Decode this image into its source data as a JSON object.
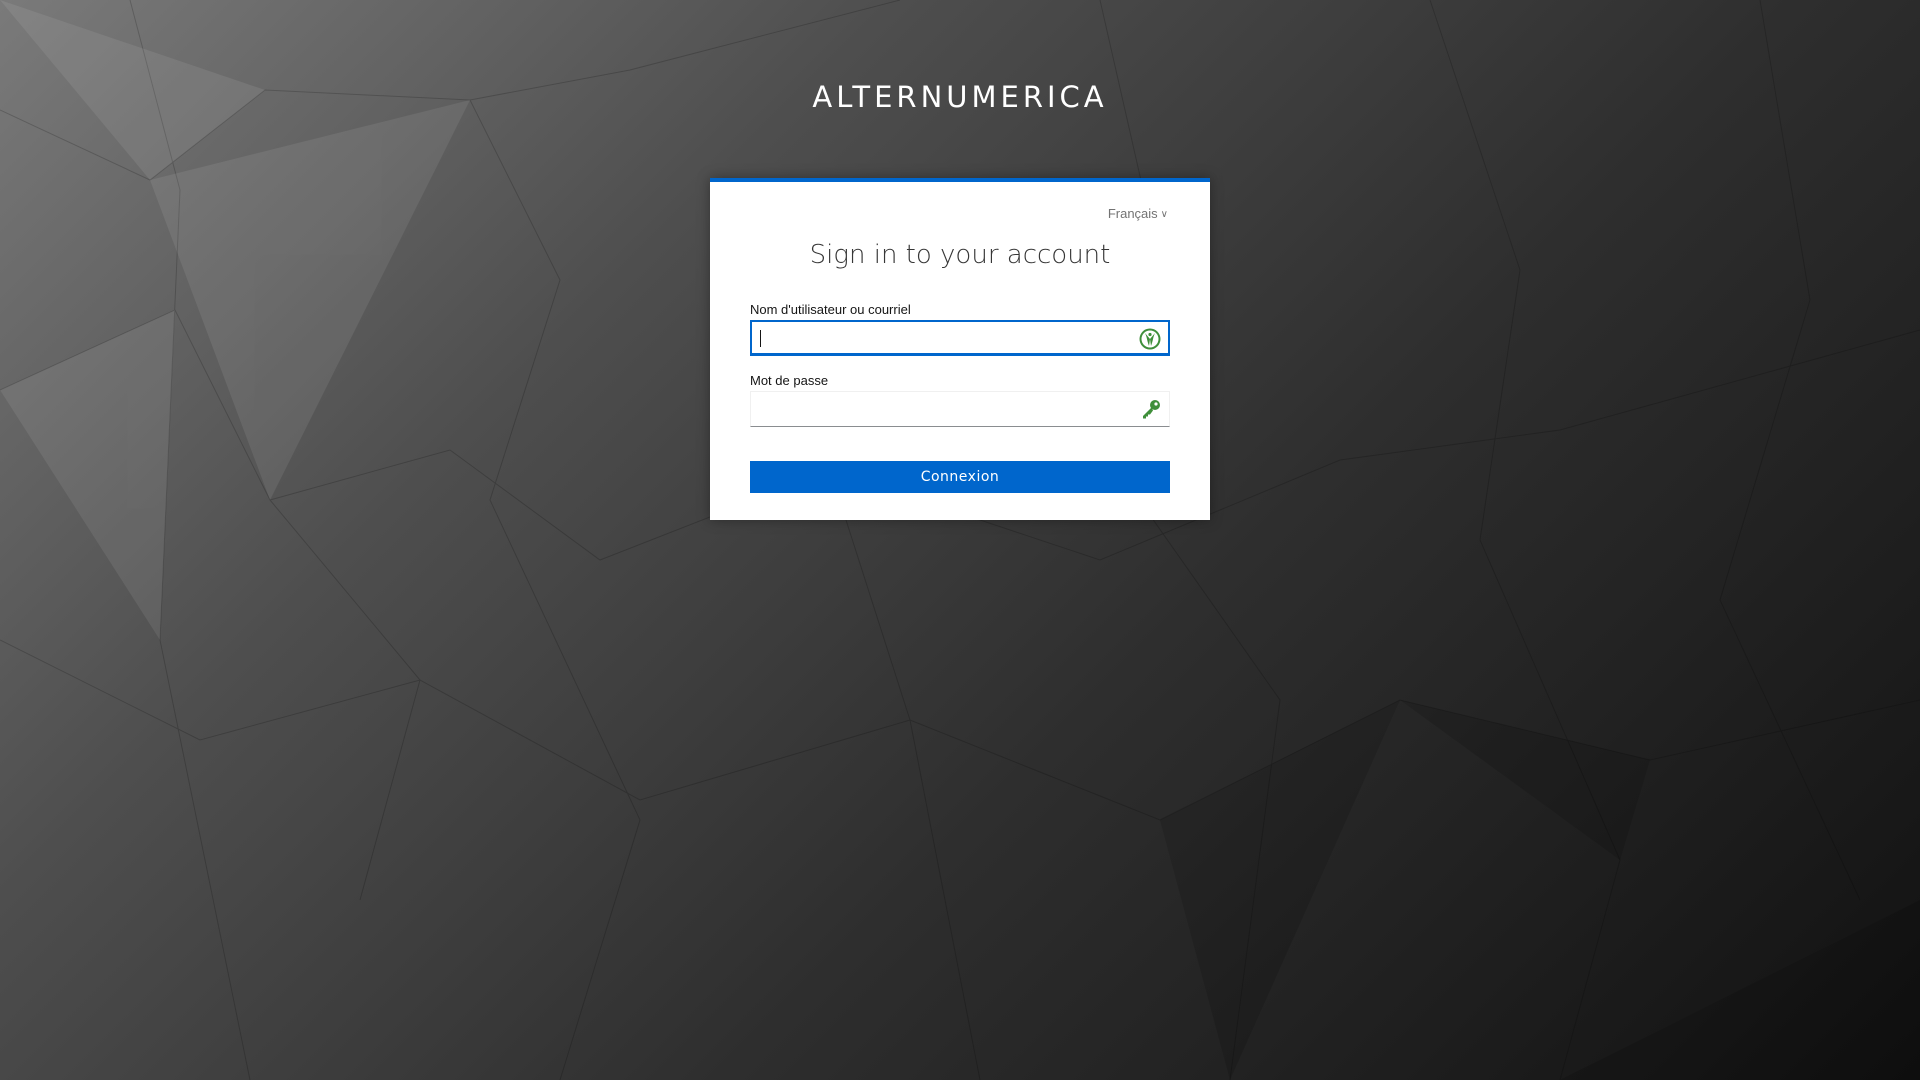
{
  "brand": {
    "name": "ALTERNUMERICA"
  },
  "login": {
    "language_label": "Français",
    "title": "Sign in to your account",
    "username_label": "Nom d'utilisateur ou courriel",
    "username_value": "",
    "password_label": "Mot de passe",
    "password_value": "",
    "submit_label": "Connexion"
  },
  "colors": {
    "accent": "#0066cc",
    "icon_green": "#3f8f3a"
  },
  "icons": {
    "language_dropdown": "chevron-down-icon",
    "username_field": "password-manager-icon",
    "password_field": "key-icon"
  }
}
